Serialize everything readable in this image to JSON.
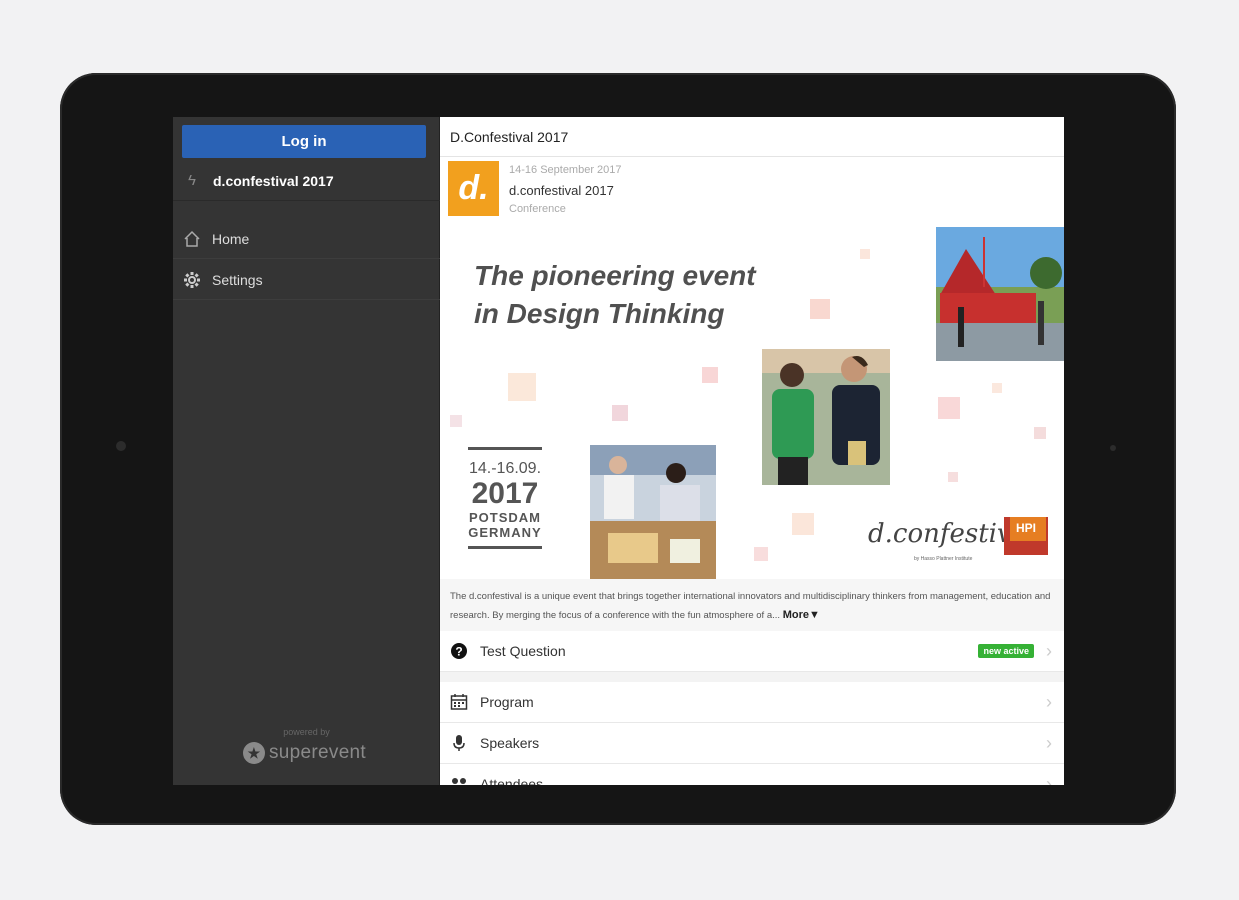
{
  "sidebar": {
    "login_label": "Log in",
    "event_label": "d.confestival 2017",
    "items": [
      {
        "label": "Home",
        "icon": "home-icon"
      },
      {
        "label": "Settings",
        "icon": "gear-icon"
      }
    ],
    "powered_by": "powered by",
    "brand": "superevent"
  },
  "main": {
    "title": "D.Confestival 2017",
    "event": {
      "logo_text": "d.",
      "date": "14-16 September 2017",
      "name": "d.confestival 2017",
      "type": "Conference"
    },
    "banner": {
      "headline_1": "The pioneering event",
      "headline_2": "in Design Thinking",
      "date_line": "14.-16.09.",
      "year": "2017",
      "city": "POTSDAM",
      "country": "GERMANY",
      "brand": "d.confestival",
      "hpi": "HPI",
      "byline": "by Hasso Plattner Institute"
    },
    "description": "The d.confestival is a unique event that brings together international innovators and multidisciplinary thinkers from management, education and research. By merging the focus of a conference with the fun atmosphere of a...",
    "more_label": "More▼",
    "question": {
      "label": "Test Question",
      "badge": "new active"
    },
    "menu": [
      {
        "label": "Program",
        "icon": "calendar-icon"
      },
      {
        "label": "Speakers",
        "icon": "microphone-icon"
      },
      {
        "label": "Attendees",
        "icon": "people-icon"
      }
    ]
  },
  "colors": {
    "login": "#2a62b5",
    "accent": "#f2a01e",
    "badge": "#35b135",
    "sidebar_bg": "#343434"
  }
}
